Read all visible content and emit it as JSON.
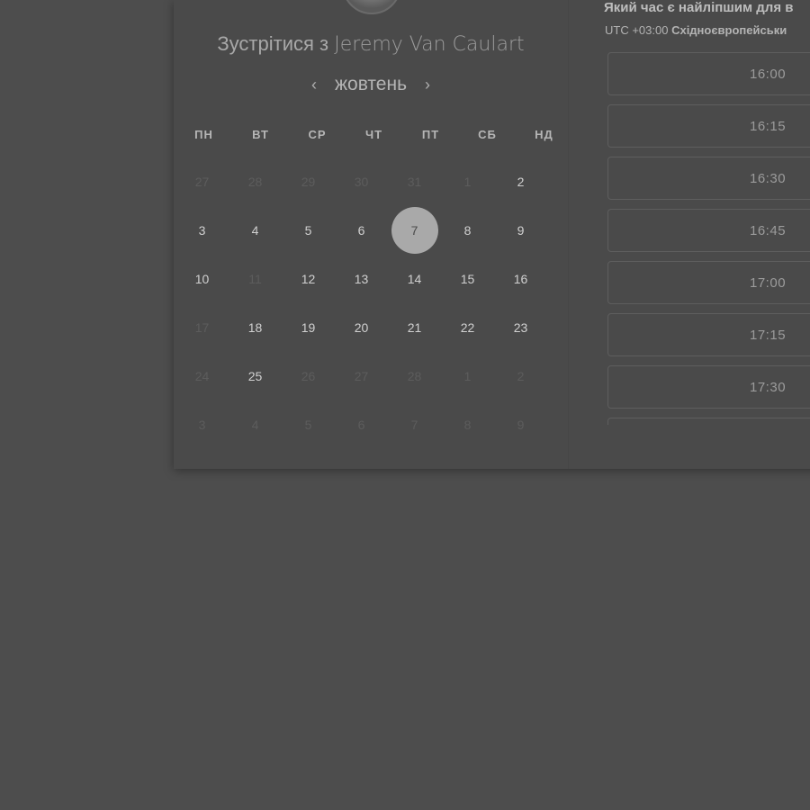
{
  "header": {
    "title_prefix": "Зустрітися з",
    "host_name": "Jeremy Van Caulart"
  },
  "calendar": {
    "month": "жовтень",
    "prev_icon": "chevron-left-icon",
    "next_icon": "chevron-right-icon",
    "weekdays": [
      "ПН",
      "ВТ",
      "СР",
      "ЧТ",
      "ПТ",
      "СБ",
      "НД"
    ],
    "selected_day": "7",
    "days": [
      {
        "label": "27",
        "muted": true
      },
      {
        "label": "28",
        "muted": true
      },
      {
        "label": "29",
        "muted": true
      },
      {
        "label": "30",
        "muted": true
      },
      {
        "label": "31",
        "muted": true
      },
      {
        "label": "1",
        "muted": true
      },
      {
        "label": "2",
        "muted": false
      },
      {
        "label": "3",
        "muted": false
      },
      {
        "label": "4",
        "muted": false
      },
      {
        "label": "5",
        "muted": false
      },
      {
        "label": "6",
        "muted": false
      },
      {
        "label": "7",
        "muted": false,
        "selected": true
      },
      {
        "label": "8",
        "muted": false
      },
      {
        "label": "9",
        "muted": false
      },
      {
        "label": "10",
        "muted": false
      },
      {
        "label": "11",
        "muted": true
      },
      {
        "label": "12",
        "muted": false
      },
      {
        "label": "13",
        "muted": false
      },
      {
        "label": "14",
        "muted": false
      },
      {
        "label": "15",
        "muted": false
      },
      {
        "label": "16",
        "muted": false
      },
      {
        "label": "17",
        "muted": true
      },
      {
        "label": "18",
        "muted": false
      },
      {
        "label": "19",
        "muted": false
      },
      {
        "label": "20",
        "muted": false
      },
      {
        "label": "21",
        "muted": false
      },
      {
        "label": "22",
        "muted": false
      },
      {
        "label": "23",
        "muted": false
      },
      {
        "label": "24",
        "muted": true
      },
      {
        "label": "25",
        "muted": false
      },
      {
        "label": "26",
        "muted": true
      },
      {
        "label": "27",
        "muted": true
      },
      {
        "label": "28",
        "muted": true
      },
      {
        "label": "1",
        "muted": true
      },
      {
        "label": "2",
        "muted": true
      },
      {
        "label": "3",
        "muted": true
      },
      {
        "label": "4",
        "muted": true
      },
      {
        "label": "5",
        "muted": true
      },
      {
        "label": "6",
        "muted": true
      },
      {
        "label": "7",
        "muted": true
      },
      {
        "label": "8",
        "muted": true
      },
      {
        "label": "9",
        "muted": true
      }
    ]
  },
  "times": {
    "question": "Який час є найліпшим для в",
    "timezone_offset": "UTC +03:00",
    "timezone_name": "Східноєвропейськи",
    "slots": [
      "16:00",
      "16:15",
      "16:30",
      "16:45",
      "17:00",
      "17:15",
      "17:30",
      ""
    ]
  },
  "colors": {
    "overlay": "#4d4d4d",
    "selected_day": "#a9a9a9"
  }
}
